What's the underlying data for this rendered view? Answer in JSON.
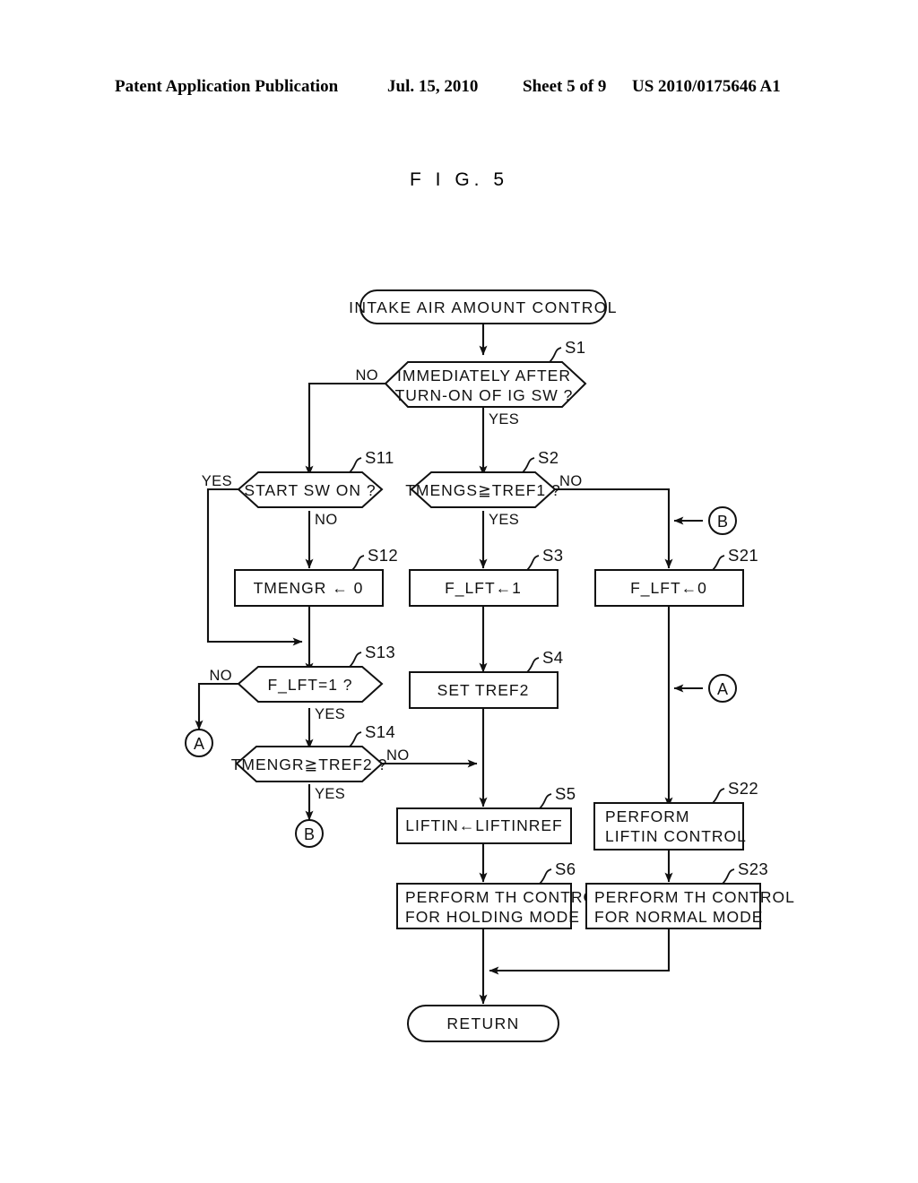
{
  "header": {
    "publication": "Patent Application Publication",
    "date": "Jul. 15, 2010",
    "sheet": "Sheet 5 of 9",
    "patent_number": "US 2010/0175646 A1"
  },
  "figure": {
    "caption": "F I G.  5"
  },
  "chart_data": {
    "type": "diagram",
    "title": "F I G.  5",
    "diagram_kind": "flowchart",
    "nodes": [
      {
        "id": "start",
        "shape": "terminal",
        "step": "",
        "text": "INTAKE AIR AMOUNT CONTROL"
      },
      {
        "id": "s1",
        "shape": "decision",
        "step": "S1",
        "text": "IMMEDIATELY AFTER",
        "text2": "TURN-ON OF IG SW ?"
      },
      {
        "id": "s11",
        "shape": "decision",
        "step": "S11",
        "text": "START SW  ON ?"
      },
      {
        "id": "s2",
        "shape": "decision",
        "step": "S2",
        "text": "TMENGS≧TREF1 ?"
      },
      {
        "id": "s12",
        "shape": "process",
        "step": "S12",
        "text": "TMENGR ← 0"
      },
      {
        "id": "s3",
        "shape": "process",
        "step": "S3",
        "text": "F_LFT←1"
      },
      {
        "id": "s21",
        "shape": "process",
        "step": "S21",
        "text": "F_LFT←0"
      },
      {
        "id": "s13",
        "shape": "decision",
        "step": "S13",
        "text": "F_LFT=1 ?"
      },
      {
        "id": "s4",
        "shape": "process",
        "step": "S4",
        "text": "SET TREF2"
      },
      {
        "id": "s14",
        "shape": "decision",
        "step": "S14",
        "text": "TMENGR≧TREF2 ?"
      },
      {
        "id": "s5",
        "shape": "process",
        "step": "S5",
        "text": "LIFTIN←LIFTINREF"
      },
      {
        "id": "s22",
        "shape": "process",
        "step": "S22",
        "text": "PERFORM",
        "text2": "LIFTIN CONTROL"
      },
      {
        "id": "s6",
        "shape": "process",
        "step": "S6",
        "text": "PERFORM TH CONTROL",
        "text2": "FOR HOLDING MODE"
      },
      {
        "id": "s23",
        "shape": "process",
        "step": "S23",
        "text": "PERFORM TH CONTROL",
        "text2": "FOR NORMAL MODE"
      },
      {
        "id": "return",
        "shape": "terminal",
        "step": "",
        "text": "RETURN"
      }
    ],
    "connectors": [
      {
        "id": "a_left",
        "label": "A"
      },
      {
        "id": "b_left",
        "label": "B"
      },
      {
        "id": "a_right",
        "label": "A"
      },
      {
        "id": "b_right",
        "label": "B"
      }
    ],
    "edge_labels": {
      "s1_no": "NO",
      "s1_yes": "YES",
      "s11_yes": "YES",
      "s11_no": "NO",
      "s2_no": "NO",
      "s2_yes": "YES",
      "s13_no": "NO",
      "s13_yes": "YES",
      "s14_no": "NO",
      "s14_yes": "YES"
    },
    "edges": [
      {
        "from": "start",
        "to": "s1",
        "label": ""
      },
      {
        "from": "s1",
        "to": "s11",
        "label": "NO"
      },
      {
        "from": "s1",
        "to": "s2",
        "label": "YES"
      },
      {
        "from": "s11",
        "to": "s13",
        "label": "YES"
      },
      {
        "from": "s11",
        "to": "s12",
        "label": "NO"
      },
      {
        "from": "s12",
        "to": "s13",
        "label": ""
      },
      {
        "from": "s2",
        "to": "s3",
        "label": "YES"
      },
      {
        "from": "s2",
        "to": "s21",
        "label": "NO"
      },
      {
        "from": "s3",
        "to": "s4",
        "label": ""
      },
      {
        "from": "s4",
        "to": "s5",
        "label": ""
      },
      {
        "from": "s13",
        "to": "a_left",
        "label": "NO"
      },
      {
        "from": "s13",
        "to": "s14",
        "label": "YES"
      },
      {
        "from": "s14",
        "to": "s5",
        "label": "NO"
      },
      {
        "from": "s14",
        "to": "b_left",
        "label": "YES"
      },
      {
        "from": "b_right",
        "to": "s21",
        "label": ""
      },
      {
        "from": "s21",
        "to": "s22",
        "label": ""
      },
      {
        "from": "a_right",
        "to": "s22",
        "label": ""
      },
      {
        "from": "s5",
        "to": "s6",
        "label": ""
      },
      {
        "from": "s22",
        "to": "s23",
        "label": ""
      },
      {
        "from": "s6",
        "to": "return",
        "label": ""
      },
      {
        "from": "s23",
        "to": "return",
        "label": ""
      }
    ],
    "colors": {
      "stroke": "#111111",
      "fill": "#ffffff",
      "background": "#ffffff"
    }
  }
}
